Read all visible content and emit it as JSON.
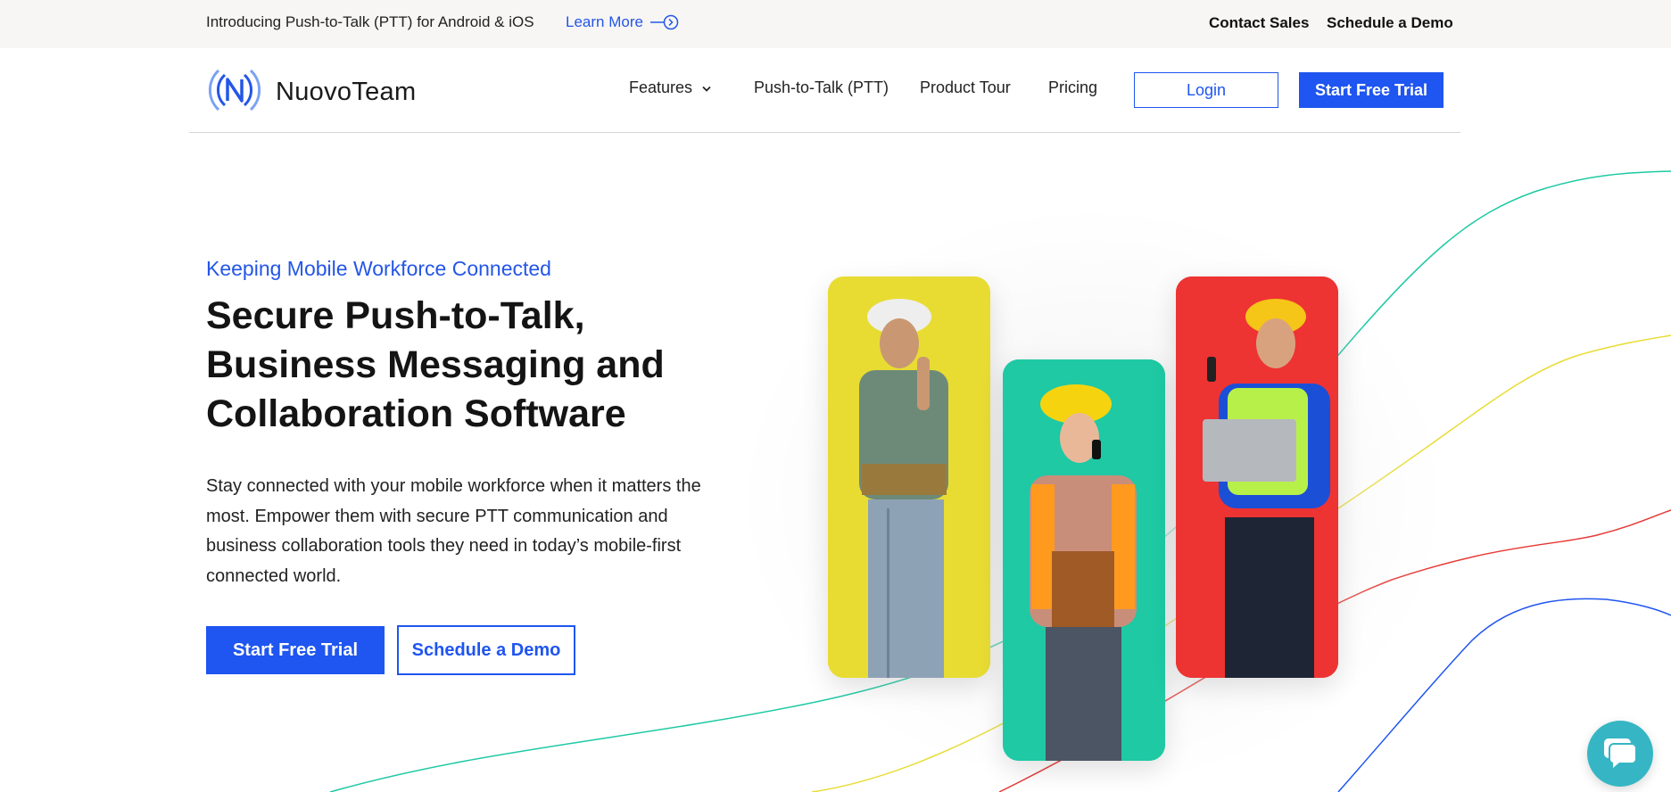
{
  "announcement": {
    "text": "Introducing Push-to-Talk (PTT) for Android & iOS",
    "link_label": "Learn More",
    "link_icon": "arrow-circle-right-icon",
    "contact_sales": "Contact Sales",
    "schedule_demo": "Schedule a Demo"
  },
  "nav": {
    "logo_icon": "nuovoteam-logo-icon",
    "brand": "NuovoTeam",
    "items": [
      {
        "label": "Features",
        "has_dropdown": true
      },
      {
        "label": "Push-to-Talk (PTT)"
      },
      {
        "label": "Product Tour"
      },
      {
        "label": "Pricing"
      }
    ],
    "login": "Login",
    "trial": "Start Free Trial"
  },
  "hero": {
    "eyebrow": "Keeping Mobile Workforce Connected",
    "title": "Secure Push-to-Talk, Business Messaging and Collaboration Software",
    "description": "Stay connected with your mobile workforce when it matters the most. Empower them with secure PTT communication and business collaboration tools they need in today’s mobile-first connected world.",
    "primary_cta": "Start Free Trial",
    "secondary_cta": "Schedule a Demo"
  },
  "images": {
    "card_left": {
      "bg": "#e8dc33",
      "subject": "worker-on-phone"
    },
    "card_middle": {
      "bg": "#1ec9a4",
      "subject": "worker-with-walkie-talkie"
    },
    "card_right": {
      "bg": "#ee3333",
      "subject": "worker-with-laptop"
    }
  },
  "colors": {
    "accent": "#1f55f0",
    "line_teal": "#1ec9a4",
    "line_yellow": "#e8dc33",
    "line_red": "#e53935",
    "line_blue": "#1f55f0",
    "chat": "#36b6c4"
  },
  "chat_widget": {
    "icon": "chat-bubble-icon"
  }
}
